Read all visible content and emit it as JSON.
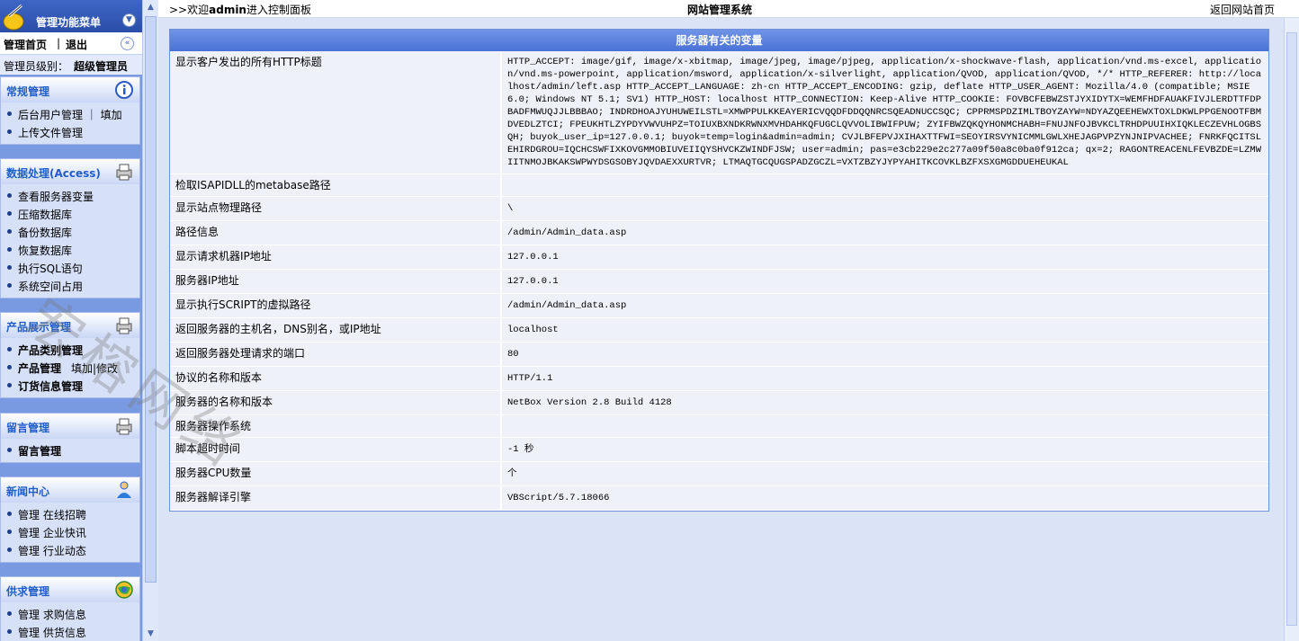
{
  "left": {
    "menu_title": "管理功能菜单",
    "home_link": "管理首页",
    "separator": "|",
    "logout_link": "退出",
    "admin_label": "管理员级别：",
    "admin_level": "超级管理员",
    "panels": [
      {
        "title": "常规管理",
        "icon": "info-icon",
        "items": [
          {
            "text": "后台用户管理 ｜ 填加",
            "bold": false
          },
          {
            "text": "上传文件管理",
            "bold": false
          }
        ]
      },
      {
        "title": "数据处理(Access)",
        "icon": "printer-icon",
        "items": [
          {
            "text": "查看服务器变量",
            "bold": false
          },
          {
            "text": "压缩数据库",
            "bold": false
          },
          {
            "text": "备份数据库",
            "bold": false
          },
          {
            "text": "恢复数据库",
            "bold": false
          },
          {
            "text": "执行SQL语句",
            "bold": false
          },
          {
            "text": "系统空间占用",
            "bold": false
          }
        ]
      },
      {
        "title": "产品展示管理",
        "icon": "printer-icon",
        "items": [
          {
            "text": "产品类别管理",
            "bold": true
          },
          {
            "text": "产品管理",
            "extra": "填加|修改",
            "bold": true
          },
          {
            "text": "订货信息管理",
            "bold": true
          }
        ]
      },
      {
        "title": "留言管理",
        "icon": "printer-icon",
        "items": [
          {
            "text": "留言管理",
            "bold": true
          }
        ]
      },
      {
        "title": "新闻中心",
        "icon": "person-icon",
        "items": [
          {
            "text": "管理  在线招聘",
            "bold": false
          },
          {
            "text": "管理  企业快讯",
            "bold": false
          },
          {
            "text": "管理  行业动态",
            "bold": false
          }
        ]
      },
      {
        "title": "供求管理",
        "icon": "globe-icon",
        "items": [
          {
            "text": "管理  求购信息",
            "bold": false
          },
          {
            "text": "管理  供货信息",
            "bold": false
          }
        ]
      }
    ]
  },
  "topbar": {
    "welcome_prefix": ">>欢迎",
    "welcome_user": "admin",
    "welcome_suffix": "进入控制面板",
    "site_title": "网站管理系统",
    "back_link": "返回网站首页"
  },
  "table": {
    "title": "服务器有关的变量",
    "rows": [
      {
        "key": "显示客户发出的所有HTTP标题",
        "value": "HTTP_ACCEPT: image/gif, image/x-xbitmap, image/jpeg, image/pjpeg, application/x-shockwave-flash, application/vnd.ms-excel, application/vnd.ms-powerpoint, application/msword, application/x-silverlight, application/QVOD, application/QVOD, */* HTTP_REFERER: http://localhost/admin/left.asp HTTP_ACCEPT_LANGUAGE: zh-cn HTTP_ACCEPT_ENCODING: gzip, deflate HTTP_USER_AGENT: Mozilla/4.0 (compatible; MSIE 6.0; Windows NT 5.1; SV1) HTTP_HOST: localhost HTTP_CONNECTION: Keep-Alive HTTP_COOKIE: FOVBCFEBWZSTJYXIDYTX=WEMFHDFAUAKFIVJLERDTTFDPBADFMWUQJJLBBBAO; INDRDHOAJYUHUWEILSTL=XMWPPULKKEAYERICVQQDFDDQQNRCSQEADNUCCSQC; CPPRMSPDZIMLTBOYZAYW=NDYAZQEEHEWXTOXLDKWLPPGENOOTFBMDVEDLZTCI; FPEUKHTLZYPDYVWVUHPZ=TOIUXBXNDKRWNXMVHDAHKQFUGCLQVVOLIBWIFPUW; ZYIFBWZQKQYHONMCHABH=FNUJNFOJBVKCLTRHDPUUIHXIQKLECZEVHLOGBSQH; buyok_user_ip=127.0.0.1; buyok=temp=login&admin=admin; CVJLBFEPVJXIHAXTTFWI=SEOYIRSVYNICMMLGWLXHEJAGPVPZYNJNIPVACHEE; FNRKFQCITSLEHIRDGROU=IQCHCSWFIXKOVGMMOBIUVEIIQYSHVCKZWINDFJSW; user=admin; pas=e3cb229e2c277a09f50a8c0ba0f912ca; qx=2; RAGONTREACENLFEVBZDE=LZMWIITNMOJBKAKSWPWYDSGSOBYJQVDAEXXURTVR; LTMAQTGCQUGSPADZGCZL=VXTZBZYJYPYAHITKCOVKLBZFXSXGMGDDUEHEUKAL"
      },
      {
        "key": "检取ISAPIDLL的metabase路径",
        "value": ""
      },
      {
        "key": "显示站点物理路径",
        "value": "\\"
      },
      {
        "key": "路径信息",
        "value": "/admin/Admin_data.asp"
      },
      {
        "key": "显示请求机器IP地址",
        "value": "127.0.0.1"
      },
      {
        "key": "服务器IP地址",
        "value": "127.0.0.1"
      },
      {
        "key": "显示执行SCRIPT的虚拟路径",
        "value": "/admin/Admin_data.asp"
      },
      {
        "key": "返回服务器的主机名，DNS别名，或IP地址",
        "value": "localhost"
      },
      {
        "key": "返回服务器处理请求的端口",
        "value": "80"
      },
      {
        "key": "协议的名称和版本",
        "value": "HTTP/1.1"
      },
      {
        "key": "服务器的名称和版本",
        "value": "NetBox Version 2.8 Build 4128"
      },
      {
        "key": "服务器操作系统",
        "value": ""
      },
      {
        "key": "脚本超时时间",
        "value": "-1 秒"
      },
      {
        "key": "服务器CPU数量",
        "value": "个"
      },
      {
        "key": "服务器解译引擎",
        "value": "VBScript/5.7.18066"
      }
    ]
  },
  "watermark": "宏榕网络"
}
